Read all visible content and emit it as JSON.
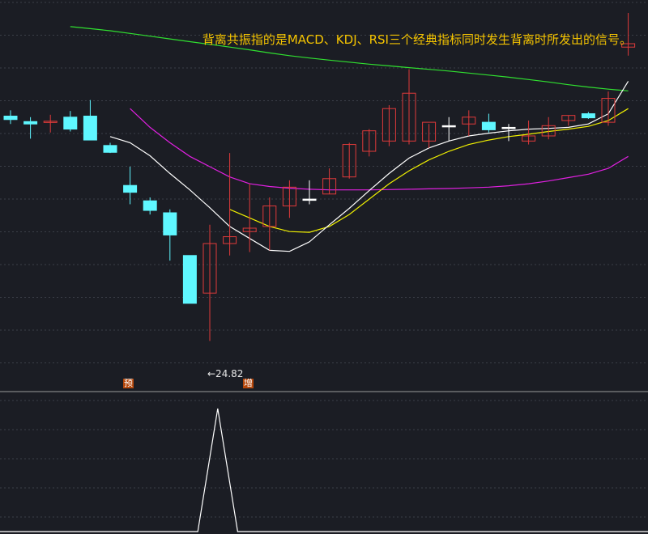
{
  "caption": "背离共振指的是MACD、KDJ、RSI三个经典指标同时发生背离时所发出的信号。",
  "markers": {
    "left": "预",
    "right": "增"
  },
  "low_label": "←24.82",
  "colors": {
    "background": "#1b1d24",
    "up": "#e03a3a",
    "down": "#5ff7ff",
    "ma_fast": "#ffffff",
    "ma_mid": "#f0f000",
    "ma_slow": "#e020e0",
    "ma_long": "#30e030",
    "grid": "#3b3e48",
    "indicator": "#ffffff",
    "caption": "#f5c400"
  },
  "chart_data": {
    "type": "candlestick",
    "title": "",
    "price_range": [
      24.0,
      34.8
    ],
    "low_value": 24.82,
    "candles": [
      {
        "o": 31.78,
        "h": 31.95,
        "l": 31.55,
        "c": 31.68
      },
      {
        "o": 31.62,
        "h": 31.75,
        "l": 31.12,
        "c": 31.55
      },
      {
        "o": 31.6,
        "h": 31.82,
        "l": 31.3,
        "c": 31.63
      },
      {
        "o": 31.75,
        "h": 31.93,
        "l": 31.33,
        "c": 31.4
      },
      {
        "o": 31.78,
        "h": 32.25,
        "l": 31.25,
        "c": 31.08
      },
      {
        "o": 30.92,
        "h": 31.0,
        "l": 30.7,
        "c": 30.72
      },
      {
        "o": 29.75,
        "h": 30.3,
        "l": 29.2,
        "c": 29.55
      },
      {
        "o": 29.3,
        "h": 29.4,
        "l": 28.9,
        "c": 29.02
      },
      {
        "o": 28.95,
        "h": 29.05,
        "l": 27.55,
        "c": 28.3
      },
      {
        "o": 27.7,
        "h": 27.7,
        "l": 26.3,
        "c": 26.3
      },
      {
        "o": 26.6,
        "h": 28.6,
        "l": 25.2,
        "c": 28.05
      },
      {
        "o": 28.05,
        "h": 30.7,
        "l": 27.7,
        "c": 28.25
      },
      {
        "o": 28.4,
        "h": 29.8,
        "l": 27.8,
        "c": 28.5
      },
      {
        "o": 28.55,
        "h": 29.4,
        "l": 27.85,
        "c": 29.15
      },
      {
        "o": 29.15,
        "h": 29.9,
        "l": 28.8,
        "c": 29.7
      },
      {
        "o": 29.35,
        "h": 29.9,
        "l": 29.2,
        "c": 29.35
      },
      {
        "o": 29.5,
        "h": 30.25,
        "l": 29.5,
        "c": 29.95
      },
      {
        "o": 30.0,
        "h": 31.0,
        "l": 29.95,
        "c": 30.95
      },
      {
        "o": 30.75,
        "h": 31.4,
        "l": 30.6,
        "c": 31.35
      },
      {
        "o": 31.05,
        "h": 32.1,
        "l": 30.9,
        "c": 32.0
      },
      {
        "o": 31.05,
        "h": 33.15,
        "l": 30.95,
        "c": 32.45
      },
      {
        "o": 31.05,
        "h": 31.55,
        "l": 30.85,
        "c": 31.6
      },
      {
        "o": 31.5,
        "h": 31.75,
        "l": 31.05,
        "c": 31.5
      },
      {
        "o": 31.55,
        "h": 31.95,
        "l": 31.2,
        "c": 31.75
      },
      {
        "o": 31.6,
        "h": 31.85,
        "l": 31.3,
        "c": 31.38
      },
      {
        "o": 31.45,
        "h": 31.55,
        "l": 31.05,
        "c": 31.45
      },
      {
        "o": 31.05,
        "h": 31.65,
        "l": 30.95,
        "c": 31.2
      },
      {
        "o": 31.2,
        "h": 31.75,
        "l": 31.1,
        "c": 31.5
      },
      {
        "o": 31.65,
        "h": 31.8,
        "l": 31.5,
        "c": 31.8
      },
      {
        "o": 31.85,
        "h": 31.9,
        "l": 31.7,
        "c": 31.73
      },
      {
        "o": 31.6,
        "h": 32.5,
        "l": 31.5,
        "c": 32.3
      },
      {
        "o": 33.8,
        "h": 34.8,
        "l": 33.55,
        "c": 33.9
      }
    ],
    "ma_fast": [
      null,
      null,
      null,
      null,
      null,
      31.18,
      31.0,
      30.62,
      30.1,
      29.62,
      29.1,
      28.55,
      28.2,
      27.85,
      27.82,
      28.1,
      28.6,
      29.08,
      29.6,
      30.1,
      30.55,
      30.85,
      31.05,
      31.2,
      31.28,
      31.35,
      31.4,
      31.42,
      31.45,
      31.55,
      31.85,
      32.8
    ],
    "ma_mid": [
      null,
      null,
      null,
      null,
      null,
      null,
      null,
      null,
      null,
      null,
      null,
      29.05,
      28.8,
      28.55,
      28.4,
      28.38,
      28.55,
      28.9,
      29.35,
      29.8,
      30.18,
      30.5,
      30.75,
      30.95,
      31.08,
      31.18,
      31.25,
      31.33,
      31.4,
      31.48,
      31.65,
      32.0
    ],
    "ma_slow": [
      null,
      null,
      null,
      null,
      null,
      null,
      32.0,
      31.45,
      31.0,
      30.6,
      30.3,
      30.0,
      29.8,
      29.72,
      29.67,
      29.64,
      29.62,
      29.62,
      29.62,
      29.63,
      29.64,
      29.65,
      29.66,
      29.68,
      29.7,
      29.74,
      29.8,
      29.88,
      29.98,
      30.08,
      30.25,
      30.6
    ],
    "ma_long": [
      null,
      null,
      null,
      34.4,
      34.34,
      34.28,
      34.2,
      34.12,
      34.04,
      33.96,
      33.88,
      33.8,
      33.72,
      33.63,
      33.55,
      33.48,
      33.42,
      33.36,
      33.3,
      33.25,
      33.2,
      33.15,
      33.1,
      33.04,
      32.98,
      32.92,
      32.85,
      32.78,
      32.7,
      32.63,
      32.57,
      32.52
    ],
    "indicator": {
      "range": [
        0,
        1
      ],
      "points": [
        [
          9.4,
          0
        ],
        [
          10.4,
          1
        ],
        [
          11.4,
          0
        ],
        [
          12.4,
          0
        ]
      ],
      "note": ""
    }
  }
}
